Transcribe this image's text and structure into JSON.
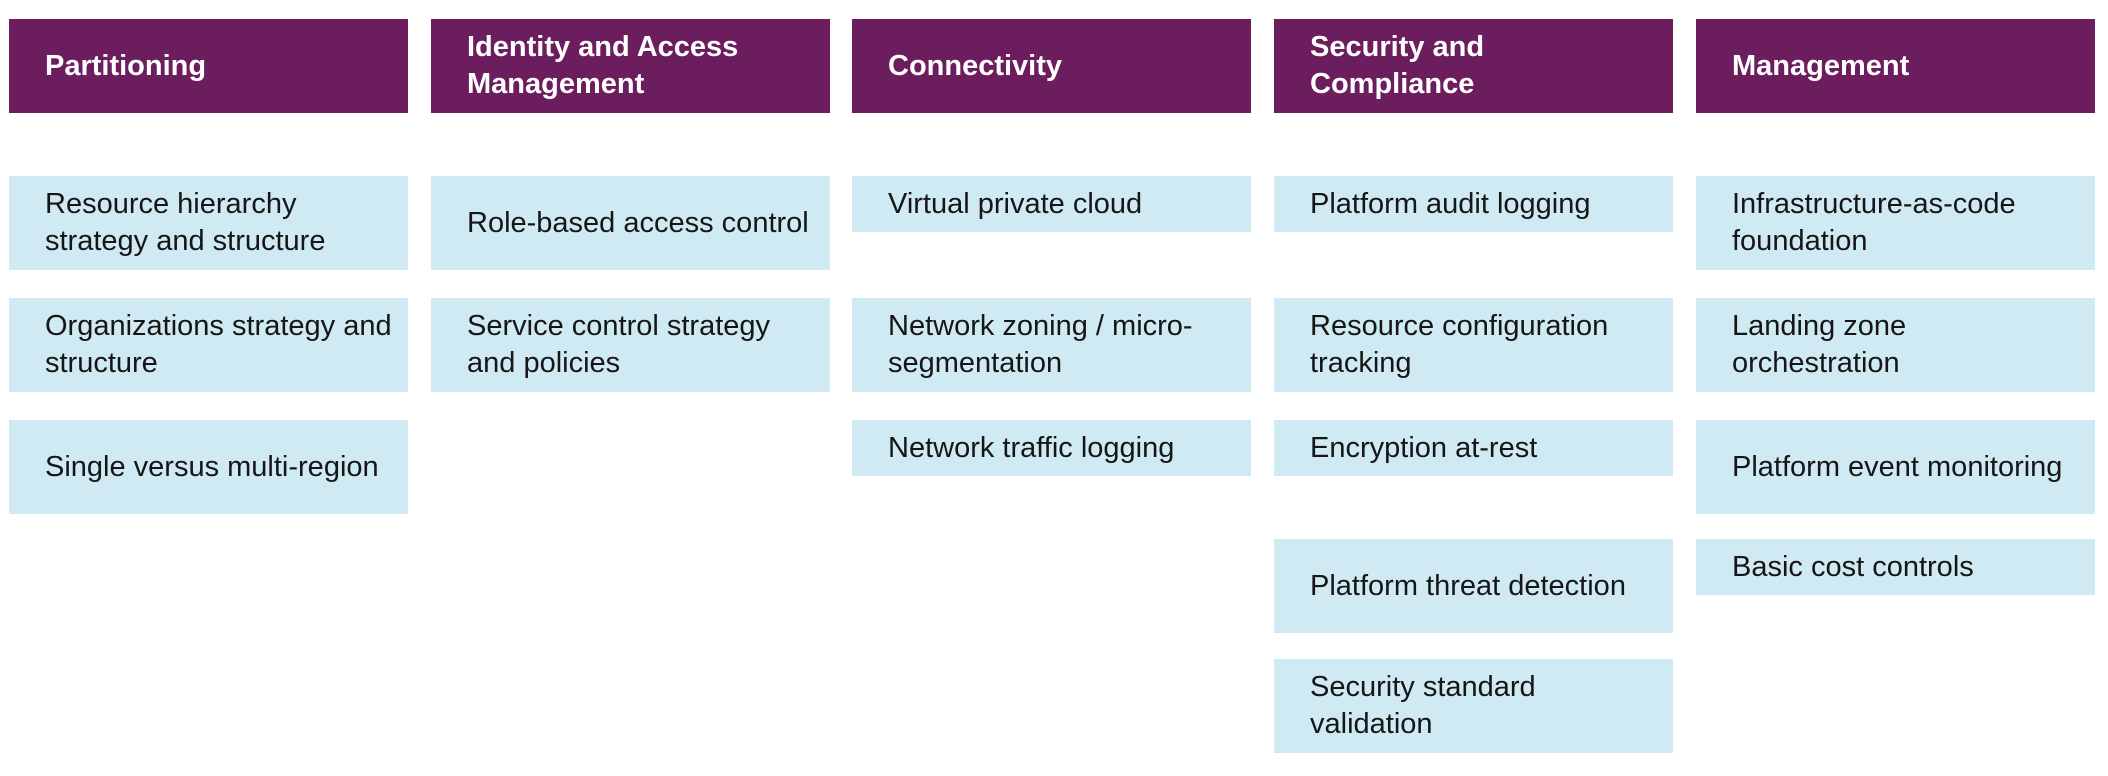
{
  "colors": {
    "header_bg": "#6b1d5e",
    "header_text": "#ffffff",
    "card_bg": "#d0eaf3",
    "card_text": "#161616"
  },
  "columns": [
    {
      "title": "Partitioning",
      "items": [
        "Resource hierarchy strategy and structure",
        "Organizations strategy and structure",
        "Single versus multi-region"
      ]
    },
    {
      "title": "Identity and Access Management",
      "items": [
        "Role-based access control",
        "Service control strategy and policies"
      ]
    },
    {
      "title": "Connectivity",
      "items": [
        "Virtual private cloud",
        "Network zoning / micro-segmentation",
        "Network traffic logging"
      ]
    },
    {
      "title": "Security and Compliance",
      "items": [
        "Platform audit logging",
        "Resource configuration tracking",
        "Encryption at-rest",
        "Platform threat detection",
        "Security standard validation"
      ]
    },
    {
      "title": "Management",
      "items": [
        "Infrastructure-as-code foundation",
        "Landing zone orchestration",
        "Platform event monitoring",
        "Basic cost controls"
      ]
    }
  ]
}
